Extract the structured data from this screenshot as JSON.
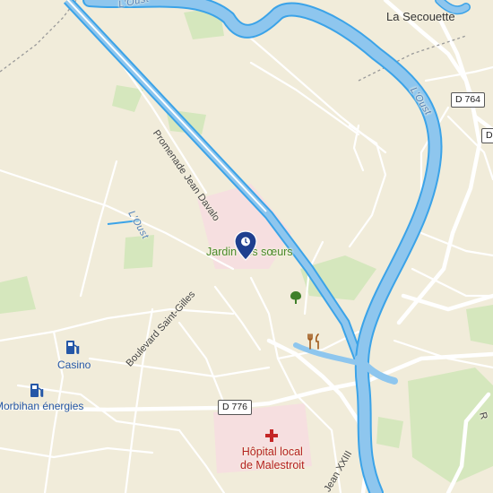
{
  "map": {
    "places": {
      "la_secouette": "La Secouette"
    },
    "water": {
      "oust_north": "L'Oust",
      "oust_east": "L'Oust",
      "oust_west": "L'Oust"
    },
    "roads": {
      "promenade": "Promenade Jean Davalo",
      "boulevard": "Boulevard Saint-Gilles",
      "jean_xxiii": "Jean XXIII",
      "d764": "D 764",
      "d776": "D 776",
      "edge_shield": "D",
      "edge_road": "R"
    },
    "pois": {
      "jardin": "Jardin des sœurs",
      "casino": "Casino",
      "morbihan": "Morbihan énergies",
      "hopital_line1": "Hôpital local",
      "hopital_line2": "de Malestroit"
    },
    "icons": {
      "marker": "location-pin-icon",
      "fuel": "fuel-station-icon",
      "hospital": "hospital-cross-icon",
      "restaurant": "restaurant-icon",
      "park": "tree-icon"
    },
    "colors": {
      "land": "#f1ecda",
      "water": "#8ec6ee",
      "river_edge": "#3ba3e8",
      "park": "#d5e7bd",
      "hospital_area": "#f6dfe0",
      "road": "#ffffff",
      "marker": "#1f3f8f"
    }
  }
}
